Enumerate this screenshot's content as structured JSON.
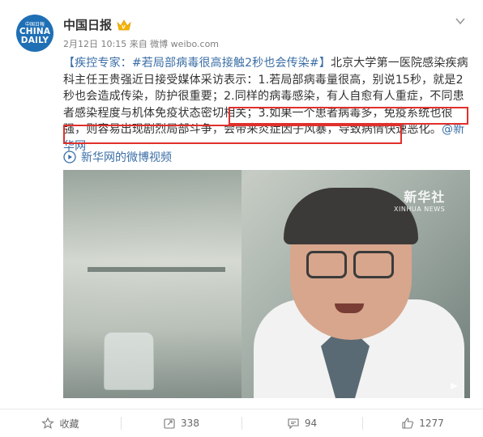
{
  "header": {
    "account_name": "中国日报",
    "avatar_small_text": "中国日報",
    "avatar_big_text_1": "CHINA",
    "avatar_big_text_2": "DAILY",
    "meta": "2月12日 10:15 来自 微博 weibo.com"
  },
  "post": {
    "tag": "【疾控专家：#若局部病毒很高接触2秒也会传染#】",
    "body_part1": "北京大学第一医院感染疾病科主任王贵强近日接受媒体采访表示：1.若局部病毒量很高，别说15秒，就是2秒也会造成传染，防护很重要；2.同样的病毒感染，有人自愈有人重症，不同患者感染程度与机体免疫状态密切相关；",
    "body_highlight": "3.如果一个患者病毒多，免疫系统也很强，则容易出现剧烈局部斗争，会带来炎症因子风暴，导致病情快速恶化。",
    "mention": "@新华网",
    "video_link": "新华网的微博视频"
  },
  "video": {
    "watermark_cn": "新华社",
    "watermark_en": "XINHUA NEWS"
  },
  "actions": [
    {
      "label": "收藏",
      "icon": "star-icon"
    },
    {
      "label": "338",
      "icon": "share-icon"
    },
    {
      "label": "94",
      "icon": "comment-icon"
    },
    {
      "label": "1277",
      "icon": "like-icon"
    }
  ],
  "colors": {
    "link": "#3a6ea5",
    "highlight_border": "#e0302c",
    "avatar_bg": "#1f6fb5"
  }
}
